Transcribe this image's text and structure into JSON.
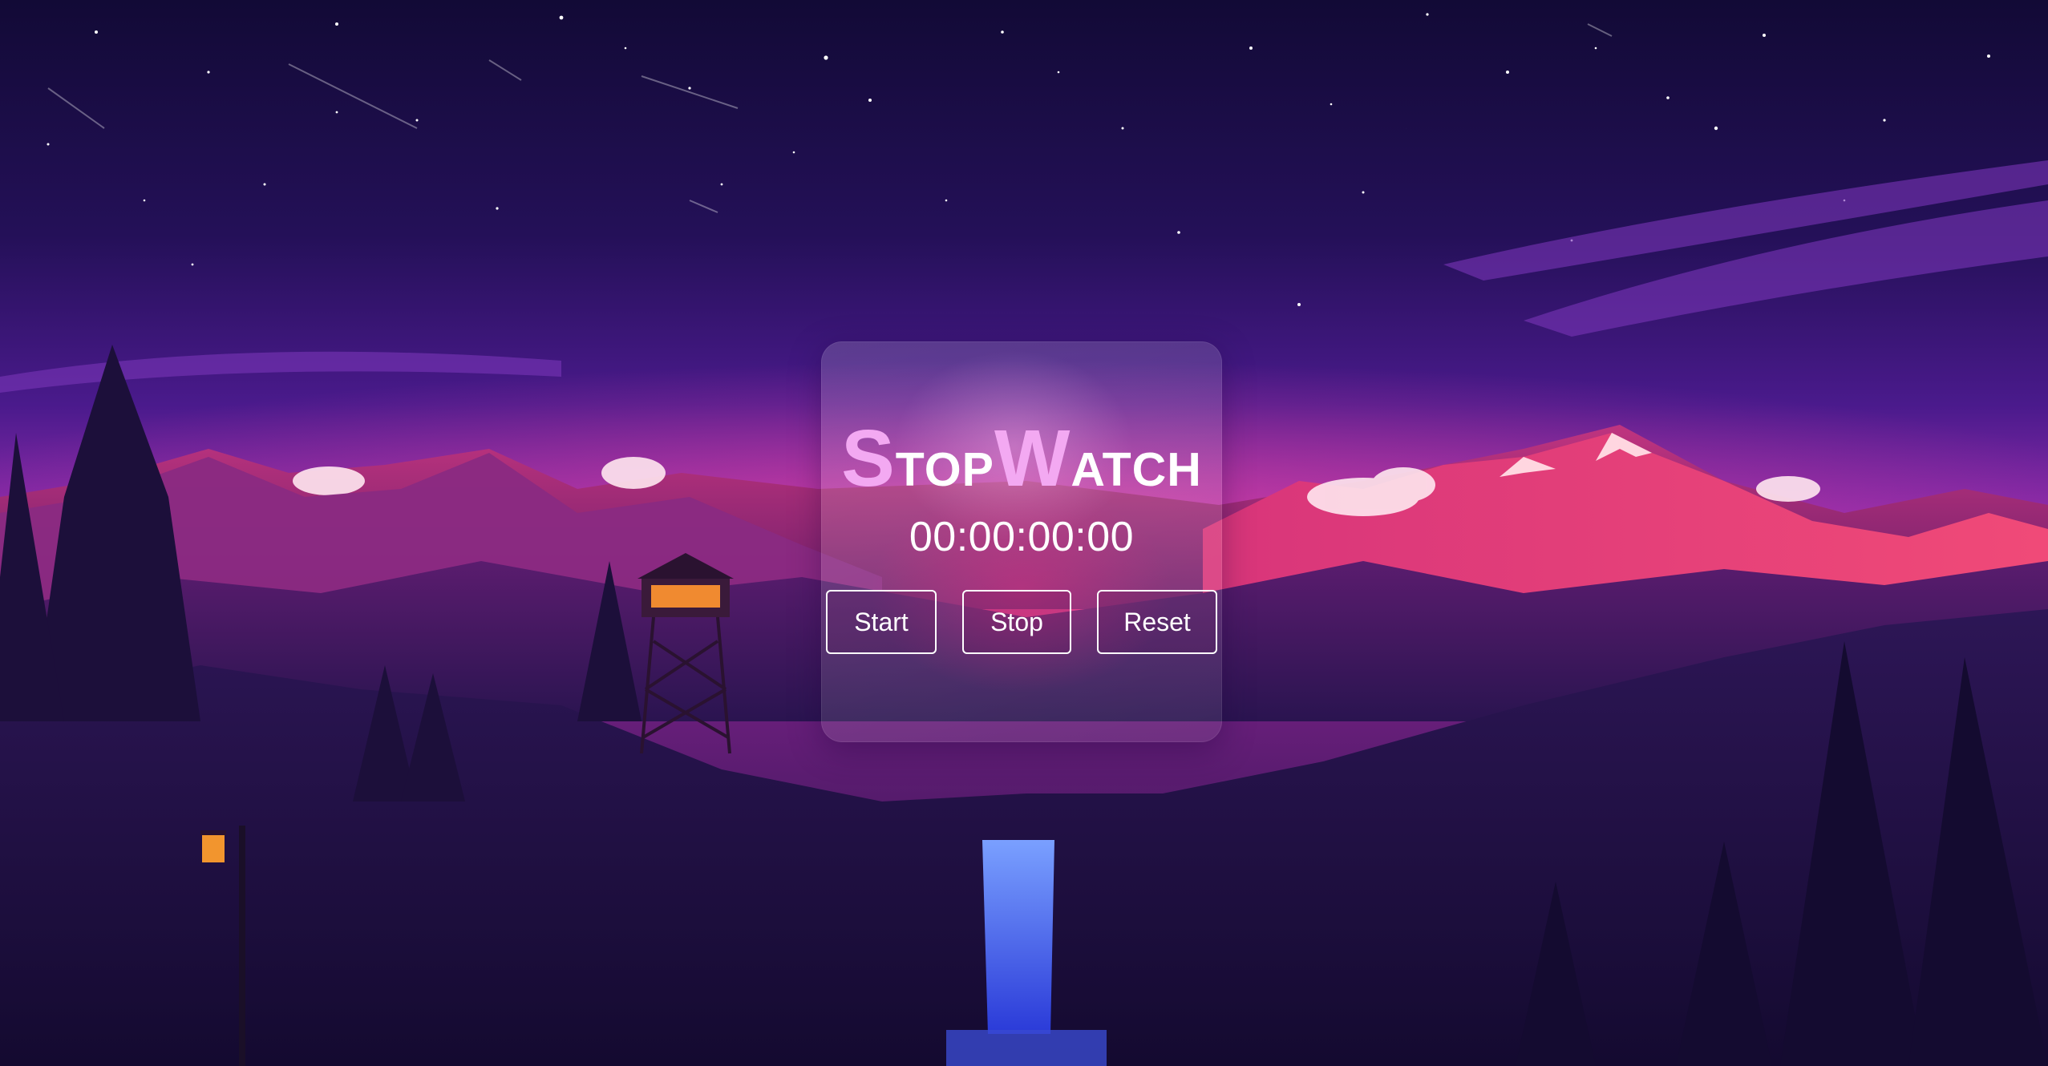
{
  "app": {
    "title_initial_1": "S",
    "title_rest_1": "top",
    "title_initial_2": "W",
    "title_rest_2": "atch"
  },
  "display": {
    "time": "00:00:00:00"
  },
  "controls": {
    "start_label": "Start",
    "stop_label": "Stop",
    "reset_label": "Reset"
  },
  "colors": {
    "accent": "#f3a9f2",
    "text": "#ffffff",
    "sky_top": "#130b3a",
    "sky_mid": "#4a1a8c",
    "horizon": "#e02e7a"
  }
}
